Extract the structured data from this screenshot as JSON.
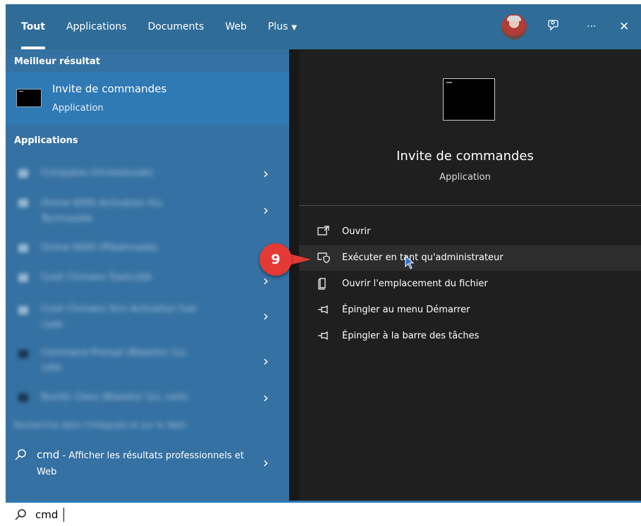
{
  "header": {
    "tabs": [
      {
        "label": "Tout",
        "active": true
      },
      {
        "label": "Applications"
      },
      {
        "label": "Documents"
      },
      {
        "label": "Web"
      },
      {
        "label": "Plus",
        "caret": "▼"
      }
    ],
    "icons": [
      "avatar",
      "feedback-icon",
      "more-icon",
      "close-icon"
    ],
    "more_glyph": "···",
    "close_glyph": "✕"
  },
  "left": {
    "best_result_header": "Meilleur résultat",
    "best_result": {
      "name": "Invite de commandes",
      "type": "Application"
    },
    "applications_header": "Applications",
    "blurred_items": [
      "Compatex (Unreadcode)",
      "Onlnw 6000 Activation fou Technoodle",
      "Onlnw 6000 (Pfedinnada)",
      "Cooh Chrnwoc Eastcobb",
      "Cooh Chrnwoc 6nn Activation  fuel cade",
      "Command Prompt (Blazoto) 1LL 10th",
      "NunOc Class (Blazoto) 1LL carb)"
    ],
    "blurred_footer": "Recherche dans l'Intégrale et sur le Web",
    "web_search": {
      "query": "cmd",
      "suffix": " - Afficher les résultats professionnels et Web"
    },
    "chevron": "›"
  },
  "right": {
    "title": "Invite de commandes",
    "subtitle": "Application",
    "actions": [
      {
        "label": "Ouvrir",
        "icon": "open-icon"
      },
      {
        "label": "Exécuter en tant qu'administrateur",
        "icon": "shield-icon",
        "hover": true
      },
      {
        "label": "Ouvrir l'emplacement du fichier",
        "icon": "folder-icon"
      },
      {
        "label": "Épingler au menu Démarrer",
        "icon": "pin-icon"
      },
      {
        "label": "Épingler à la barre des tâches",
        "icon": "pin-icon"
      }
    ]
  },
  "search": {
    "value": "cmd"
  },
  "annotation": {
    "step": "9"
  },
  "colors": {
    "header_bg": "#2f6c97",
    "left_bg": "#3571a2",
    "selected_bg": "#2f79b5",
    "right_bg": "#1f1f1f",
    "badge": "#e53935"
  }
}
